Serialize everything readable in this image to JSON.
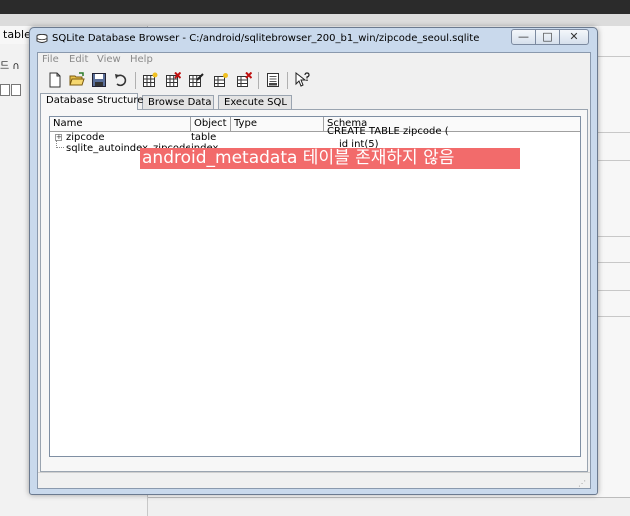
{
  "background_app": {
    "tab_label": "table",
    "row_text": "드 ∩"
  },
  "window": {
    "title": "SQLite Database Browser - C:/android/sqlitebrowser_200_b1_win/zipcode_seoul.sqlite",
    "controls": {
      "minimize": "—",
      "maximize": "□",
      "close": "✕"
    }
  },
  "menu": {
    "items": [
      "File",
      "Edit",
      "View",
      "Help"
    ]
  },
  "toolbar": {
    "icons": [
      "new-database-icon",
      "open-database-icon",
      "save-icon",
      "undo-icon",
      "create-table-icon",
      "delete-table-icon",
      "modify-table-icon",
      "create-index-icon",
      "delete-index-icon",
      "query-icon",
      "whats-this-icon"
    ]
  },
  "tabs": [
    {
      "label": "Database Structure",
      "active": true
    },
    {
      "label": "Browse Data",
      "active": false
    },
    {
      "label": "Execute SQL",
      "active": false
    }
  ],
  "tree": {
    "columns": [
      "Name",
      "Object",
      "Type",
      "Schema"
    ],
    "rows": [
      {
        "expander": "+",
        "name": "zipcode",
        "object": "table",
        "type": "",
        "schema": "CREATE TABLE zipcode ("
      },
      {
        "expander": "",
        "name": "sqlite_autoindex_zipcode_1",
        "object": "index",
        "type": "",
        "schema": "_id        int(5)"
      }
    ]
  },
  "annotation": {
    "text": "android_metadata 테이블 존재하지 않음",
    "color": "#f26b6b"
  }
}
